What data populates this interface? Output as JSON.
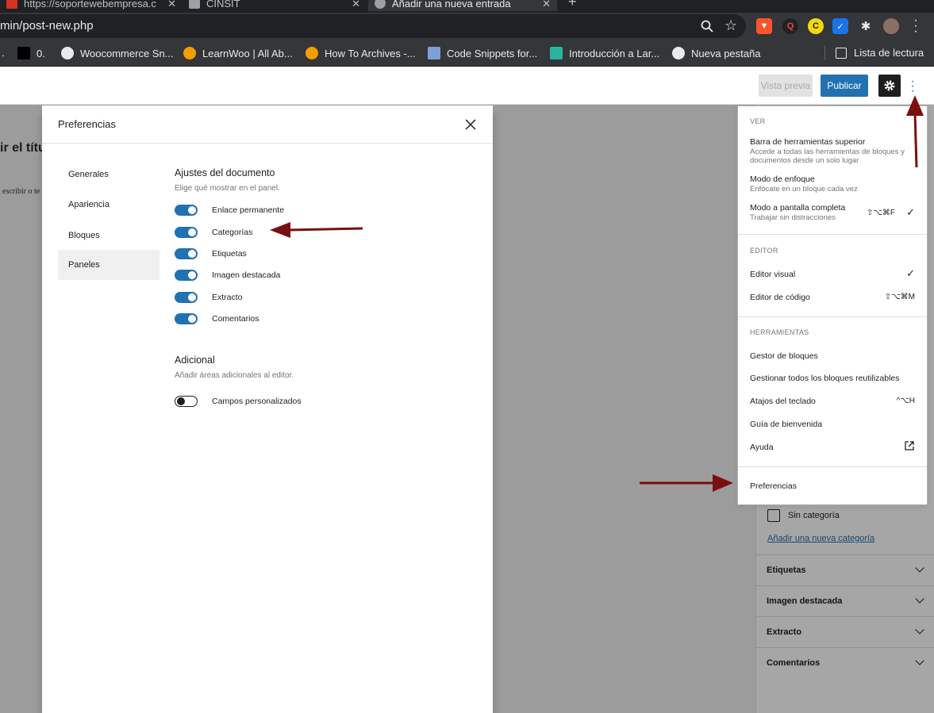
{
  "browser": {
    "tabs": [
      {
        "title": "https://soportewebempresa.c"
      },
      {
        "title": "CINSIT"
      },
      {
        "title": "Añadir una nueva entrada"
      }
    ],
    "url": "min/post-new.php",
    "bookmarks": [
      {
        "label": "0."
      },
      {
        "label": "Woocommerce Sn..."
      },
      {
        "label": "LearnWoo | All Ab..."
      },
      {
        "label": "How To Archives -..."
      },
      {
        "label": "Code Snippets for..."
      },
      {
        "label": "Introducción a Lar..."
      },
      {
        "label": "Nueva pestaña"
      }
    ],
    "reading_list": "Lista de lectura"
  },
  "editor": {
    "preview_label": "Vista previa",
    "publish_label": "Publicar",
    "title_fragment": "ir el títu",
    "hint_fragment": "escribir o te"
  },
  "modal": {
    "title": "Preferencias",
    "nav": [
      {
        "label": "Generales"
      },
      {
        "label": "Apariencia"
      },
      {
        "label": "Bloques"
      },
      {
        "label": "Paneles",
        "active": true
      }
    ],
    "document_section": {
      "title": "Ajustes del documento",
      "description": "Elige qué mostrar en el panel.",
      "toggles": [
        {
          "label": "Enlace permanente",
          "on": true
        },
        {
          "label": "Categorías",
          "on": true
        },
        {
          "label": "Etiquetas",
          "on": true
        },
        {
          "label": "Imagen destacada",
          "on": true
        },
        {
          "label": "Extracto",
          "on": true
        },
        {
          "label": "Comentarios",
          "on": true
        }
      ]
    },
    "additional_section": {
      "title": "Adicional",
      "description": "Añadir áreas adicionales al editor.",
      "toggles": [
        {
          "label": "Campos personalizados",
          "on": false
        }
      ]
    }
  },
  "menu": {
    "view": {
      "label": "Ver",
      "items": [
        {
          "label": "Barra de herramientas superior",
          "sub": "Accede a todas las herramientas de bloques y documentos desde un solo lugar"
        },
        {
          "label": "Modo de enfoque",
          "sub": "Enfócate en un bloque cada vez"
        },
        {
          "label": "Modo a pantalla completa",
          "sub": "Trabajar sin distracciones",
          "shortcut": "⇧⌥⌘F",
          "check": "✓"
        }
      ]
    },
    "editor": {
      "label": "Editor",
      "items": [
        {
          "label": "Editor visual",
          "check": "✓"
        },
        {
          "label": "Editor de código",
          "shortcut": "⇧⌥⌘M"
        }
      ]
    },
    "tools": {
      "label": "Herramientas",
      "items": [
        {
          "label": "Gestor de bloques"
        },
        {
          "label": "Gestionar todos los bloques reutilizables"
        },
        {
          "label": "Atajos del teclado",
          "shortcut": "^⌥H"
        },
        {
          "label": "Guía de bienvenida"
        },
        {
          "label": "Ayuda"
        }
      ]
    },
    "preferences_label": "Preferencias"
  },
  "sidebar": {
    "category_checkbox": "Sin categoría",
    "add_category_link": "Añadir una nueva categoría",
    "panels": [
      {
        "label": "Etiquetas"
      },
      {
        "label": "Imagen destacada"
      },
      {
        "label": "Extracto"
      },
      {
        "label": "Comentarios"
      }
    ]
  },
  "colors": {
    "accent": "#2271b1",
    "arrow": "#7a0f0f"
  }
}
